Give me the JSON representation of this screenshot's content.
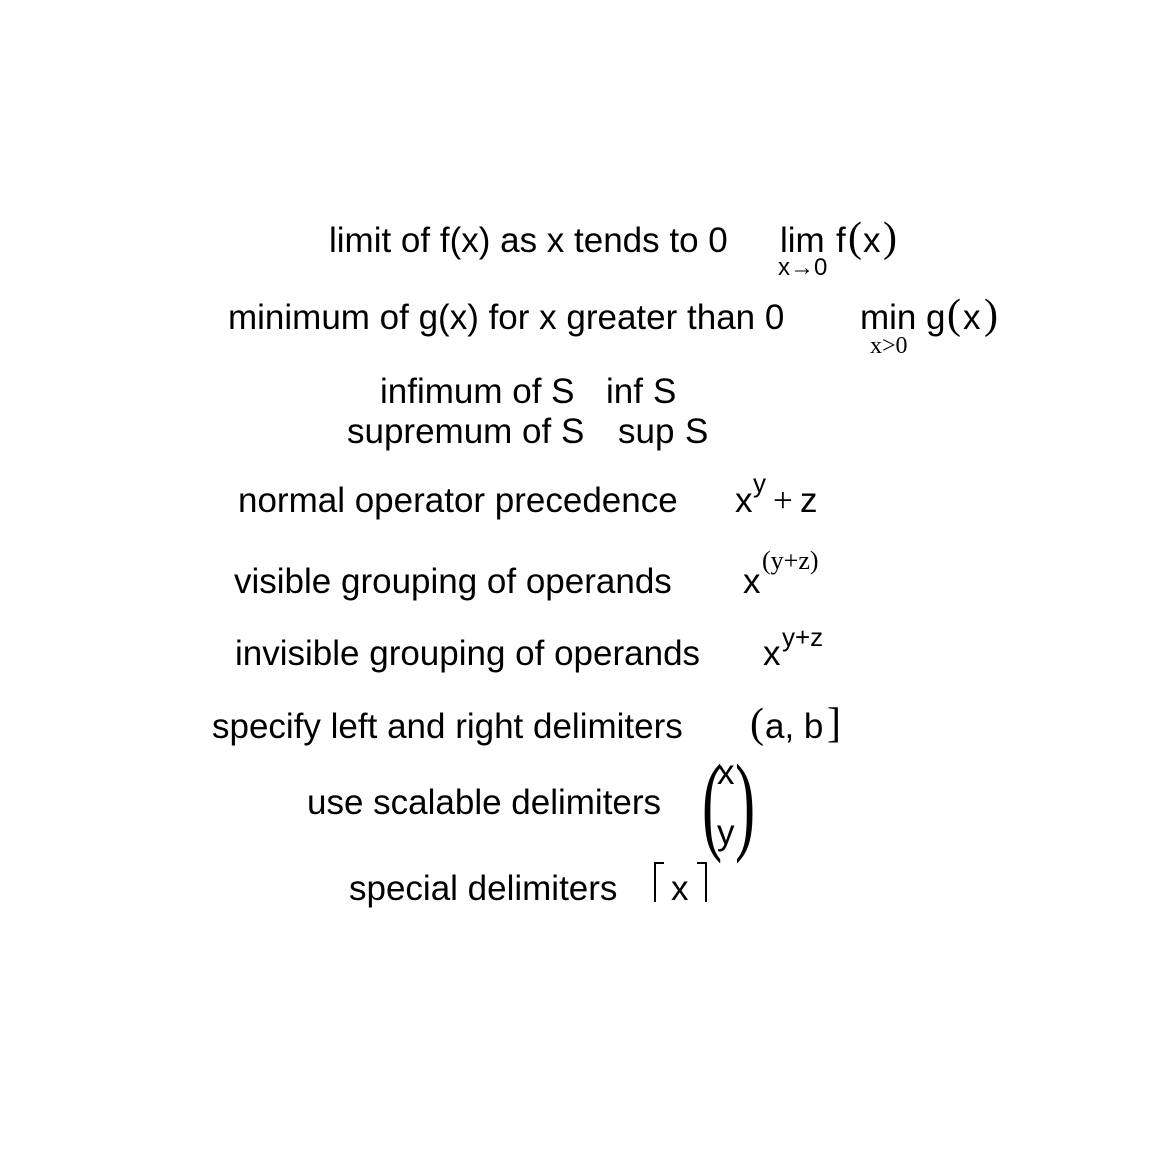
{
  "lines": {
    "limit": {
      "text": "limit of f(x) as x tends to 0",
      "op": "lim",
      "op_sub": "x→0",
      "fn": "f",
      "lparen": "(",
      "arg": "x",
      "rparen": ")"
    },
    "minimum": {
      "text": "minimum of g(x) for x greater than 0",
      "op": "min",
      "op_sub": "x>0",
      "fn": "g",
      "lparen": "(",
      "arg": "x",
      "rparen": ")"
    },
    "infimum": {
      "text": "infimum of S",
      "op": "inf",
      "arg": "S"
    },
    "supremum": {
      "text": "supremum of S",
      "op": "sup",
      "arg": "S"
    },
    "normal_precedence": {
      "text": "normal operator precedence",
      "base": "x",
      "exp": "y",
      "plus": "+",
      "term": "z"
    },
    "visible_grouping": {
      "text": "visible grouping of operands",
      "base": "x",
      "exp": "(y+z)"
    },
    "invisible_grouping": {
      "text": "invisible grouping of operands",
      "base": "x",
      "exp": "y+z"
    },
    "delimiters": {
      "text": "specify left and right delimiters",
      "left": "(",
      "content": "a, b",
      "right": "]"
    },
    "scalable": {
      "text": "use scalable delimiters",
      "left": "(",
      "top": "x",
      "bottom": "y",
      "right": ")"
    },
    "special": {
      "text": "special delimiters",
      "content": "x"
    }
  }
}
